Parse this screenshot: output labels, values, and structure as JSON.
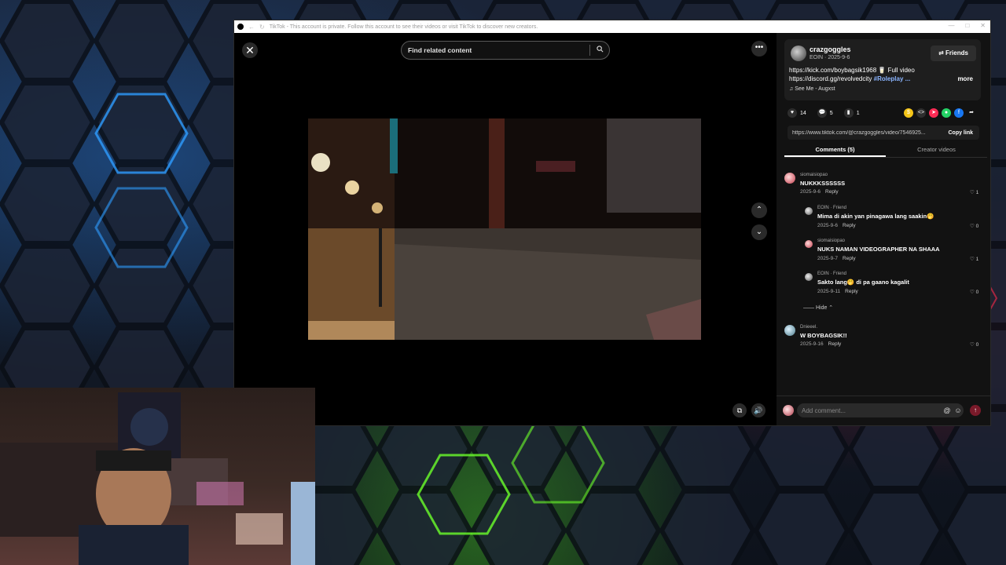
{
  "window": {
    "title": "TikTok - This account is private. Follow this account to see their videos or visit TikTok to discover new creators.",
    "controls": [
      "—",
      "□",
      "✕"
    ]
  },
  "video": {
    "search_placeholder": "Find related content",
    "close_symbol": "✕",
    "more_symbol": "•••",
    "up_symbol": "⌃",
    "down_symbol": "⌄"
  },
  "post": {
    "author": "crazgoggles",
    "sub": "EOIN · 2025-9-6",
    "friends_label": "Friends",
    "desc_line1": "https://kick.com/boybagsik1968 🥛 Full video",
    "desc_line2": "https://discord.gg/revolvedcity",
    "hashtag": "#Roleplay ...",
    "more_label": "more",
    "music": "♫ See Me - Augxst",
    "likes": "14",
    "comments": "5",
    "saves": "1",
    "link_url": "https://www.tiktok.com/@crazgoggles/video/7546925...",
    "copy_label": "Copy link"
  },
  "tabs": [
    {
      "label": "Comments (5)",
      "active": true
    },
    {
      "label": "Creator videos",
      "active": false
    }
  ],
  "comments": [
    {
      "name": "siomaisiopao",
      "text": "NUKKKSSSSSS",
      "date": "2025-9-6",
      "reply": "Reply",
      "likes": "1"
    },
    {
      "name": "EOIN · Friend",
      "text": "Mima di akin yan pinagawa lang saakin🤭",
      "date": "2025-9-6",
      "reply": "Reply",
      "likes": "0"
    },
    {
      "name": "siomaisiopao",
      "text": "NUKS NAMAN VIDEOGRAPHER NA SHAAA",
      "date": "2025-9-7",
      "reply": "Reply",
      "likes": "1"
    },
    {
      "name": "EOIN · Friend",
      "text": "Sakto lang🤭 di pa gaano kagalit",
      "date": "2025-9-11",
      "reply": "Reply",
      "likes": "0"
    },
    {
      "name": "Dnieeel.",
      "text": "W BOYBAGSIK!!",
      "date": "2025-9-16",
      "reply": "Reply",
      "likes": "0"
    }
  ],
  "hide_label": "Hide",
  "comment_input": {
    "placeholder": "Add comment..."
  },
  "colors": {
    "accent_link": "#8ab4ff",
    "panel_bg": "#121212"
  }
}
